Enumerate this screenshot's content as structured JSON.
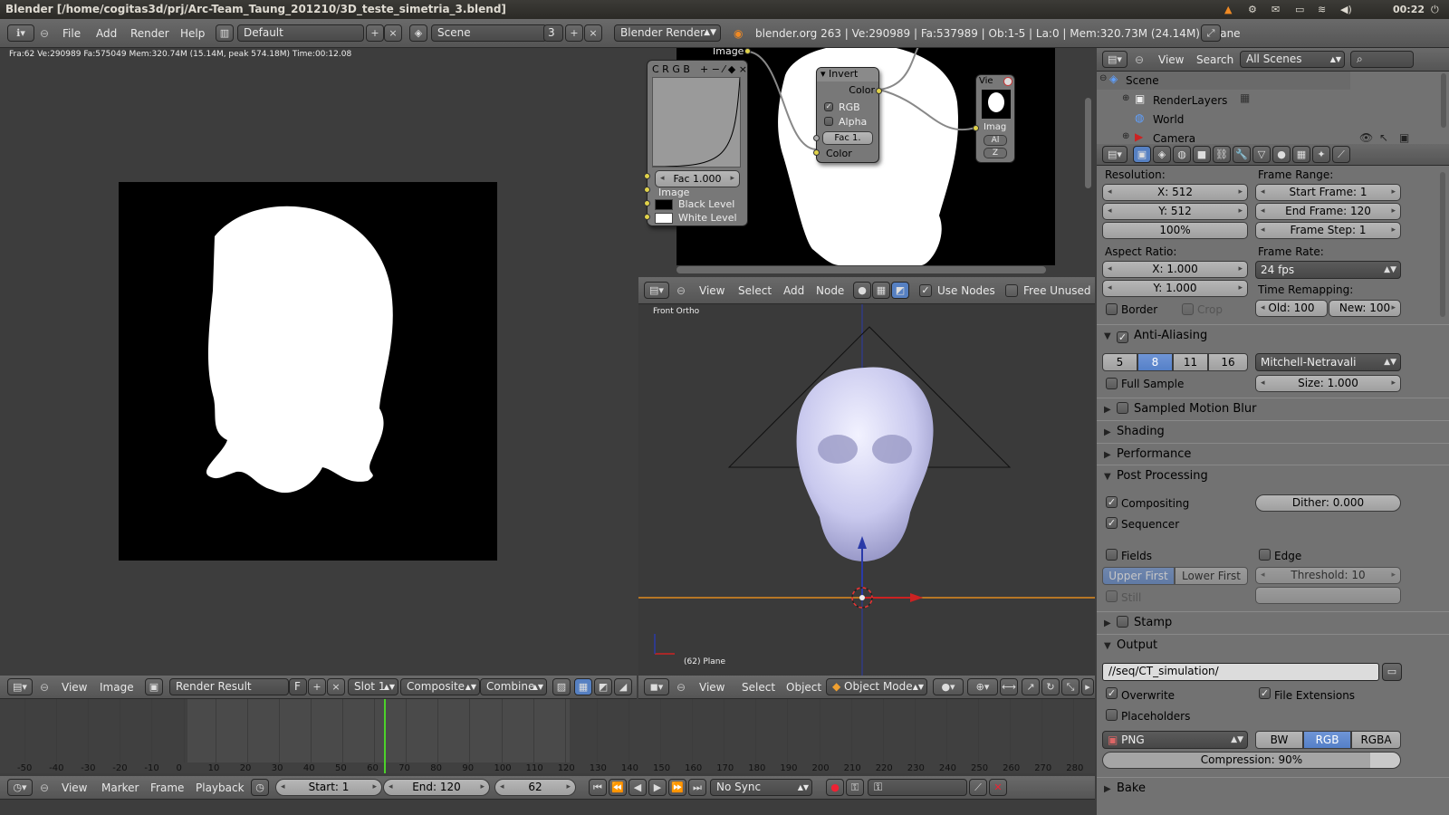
{
  "os_bar": {
    "title": "Blender [/home/cogitas3d/prj/Arc-Team_Taung_201210/3D_teste_simetria_3.blend]",
    "clock": "00:22"
  },
  "info_header": {
    "menus": [
      "File",
      "Add",
      "Render",
      "Help"
    ],
    "layout": "Default",
    "scene": "Scene",
    "scene_users": "3",
    "engine": "Blender Render",
    "stats": "blender.org 263 | Ve:290989 | Fa:537989 | Ob:1-5 | La:0 | Mem:320.73M (24.14M) | Plane"
  },
  "image_editor": {
    "status": "Fra:62  Ve:290989 Fa:575049 Mem:320.74M (15.14M, peak 574.18M) Time:00:12.08",
    "menus": [
      "View",
      "Image"
    ],
    "image_name": "Render Result",
    "fake_user": "F",
    "slot": "Slot 1",
    "pass": "Composite",
    "combine": "Combine"
  },
  "node_editor": {
    "curves_node": {
      "channels": "C R G B",
      "tools": "+ − ⁄ ◆ ×",
      "fac": "Fac 1.000",
      "image": "Image",
      "black": "Black Level",
      "white": "White Level"
    },
    "image_label": "Image",
    "invert": {
      "title": "Invert",
      "color_out": "Color",
      "rgb": "RGB",
      "alpha": "Alpha",
      "fac": "Fac 1.",
      "color_in": "Color"
    },
    "viewer": {
      "title": "Vie",
      "imag": "Imag",
      "a": "Al",
      "z": "Z"
    },
    "menus": [
      "View",
      "Select",
      "Add",
      "Node"
    ],
    "use_nodes": "Use Nodes",
    "free_unused": "Free Unused"
  },
  "viewport": {
    "view_label": "Front Ortho",
    "object_label": "(62) Plane",
    "menus": [
      "View",
      "Select",
      "Object"
    ],
    "mode": "Object Mode"
  },
  "outliner": {
    "menus": [
      "View",
      "Search"
    ],
    "display": "All Scenes",
    "items": [
      "Scene",
      "RenderLayers",
      "World",
      "Camera"
    ]
  },
  "properties": {
    "resolution_label": "Resolution:",
    "res_x": "X: 512",
    "res_y": "Y: 512",
    "res_pct": "100%",
    "frame_range_label": "Frame Range:",
    "start": "Start Frame: 1",
    "end": "End Frame: 120",
    "step": "Frame Step: 1",
    "aspect_label": "Aspect Ratio:",
    "asp_x": "X: 1.000",
    "asp_y": "Y: 1.000",
    "fps_label": "Frame Rate:",
    "fps": "24 fps",
    "remap_label": "Time Remapping:",
    "old": "Old: 100",
    "new": "New: 100",
    "border": "Border",
    "crop": "Crop",
    "aa": "Anti-Aliasing",
    "aa_samples": [
      "5",
      "8",
      "11",
      "16"
    ],
    "aa_filter": "Mitchell-Netravali",
    "full_sample": "Full Sample",
    "size": "Size: 1.000",
    "smb": "Sampled Motion Blur",
    "shading": "Shading",
    "performance": "Performance",
    "post": "Post Processing",
    "compositing": "Compositing",
    "dither": "Dither: 0.000",
    "sequencer": "Sequencer",
    "fields": "Fields",
    "edge": "Edge",
    "upper": "Upper First",
    "lower": "Lower First",
    "threshold": "Threshold: 10",
    "still": "Still",
    "stamp": "Stamp",
    "output": "Output",
    "path": "//seq/CT_simulation/",
    "overwrite": "Overwrite",
    "file_ext": "File Extensions",
    "placeholders": "Placeholders",
    "format": "PNG",
    "color_modes": [
      "BW",
      "RGB",
      "RGBA"
    ],
    "compression": "Compression: 90%",
    "bake": "Bake"
  },
  "timeline": {
    "ticks": [
      "-50",
      "-40",
      "-30",
      "-20",
      "-10",
      "0",
      "10",
      "20",
      "30",
      "40",
      "50",
      "60",
      "70",
      "80",
      "90",
      "100",
      "110",
      "120",
      "130",
      "140",
      "150",
      "160",
      "170",
      "180",
      "190",
      "200",
      "210",
      "220",
      "230",
      "240",
      "250",
      "260",
      "270",
      "280"
    ],
    "menus": [
      "View",
      "Marker",
      "Frame",
      "Playback"
    ],
    "start": "Start: 1",
    "end": "End: 120",
    "current": "62",
    "sync": "No Sync",
    "current_frame": 62
  },
  "colors": {
    "accent": "#5680c2",
    "frame_line": "#4cd12a",
    "x_axis": "#e08a1e"
  }
}
